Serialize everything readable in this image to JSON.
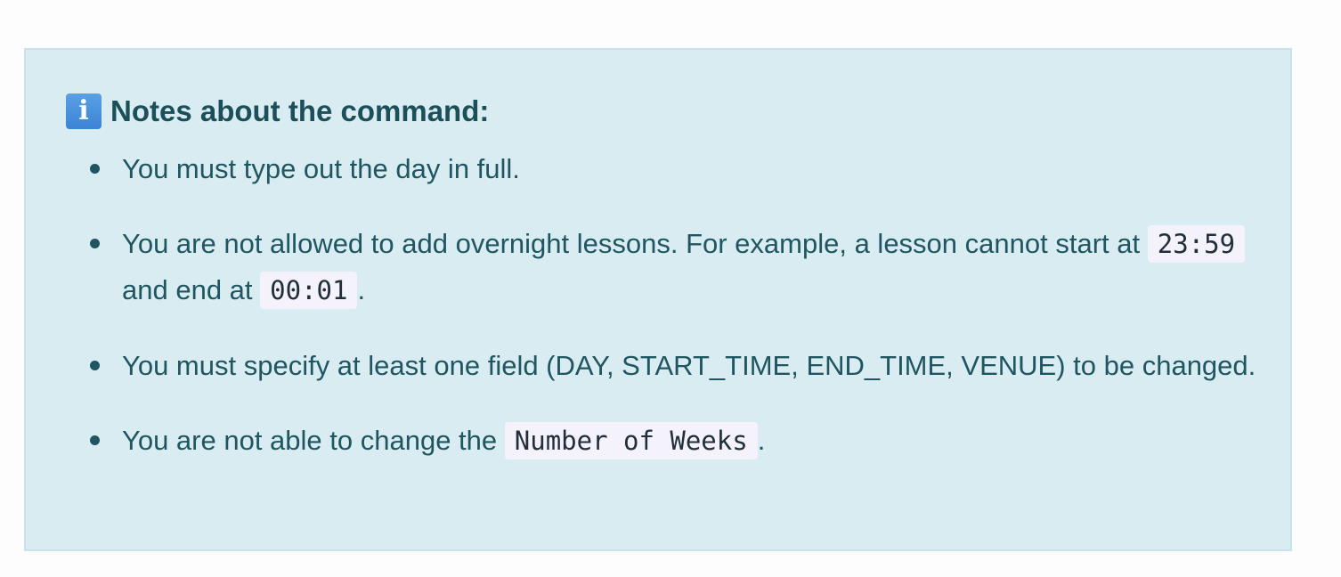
{
  "alert": {
    "icon": "info-icon",
    "icon_glyph": "i",
    "title": "Notes about the command:",
    "colors": {
      "background": "#d9ecf1",
      "border": "#c6e3ea",
      "text": "#1f5661",
      "icon": "#3c84d4",
      "code_background": "#f4f2fb"
    },
    "notes": [
      {
        "text": "You must type out the day in full."
      },
      {
        "part1": "You are not allowed to add overnight lessons. For example, a lesson cannot start at",
        "code1": "23:59",
        "part2": "and end at",
        "code2": "00:01",
        "part3": "."
      },
      {
        "text": "You must specify at least one field (DAY, START_TIME, END_TIME, VENUE) to be changed."
      },
      {
        "part1": "You are not able to change the",
        "code1": "Number of Weeks",
        "part2": "."
      }
    ]
  }
}
